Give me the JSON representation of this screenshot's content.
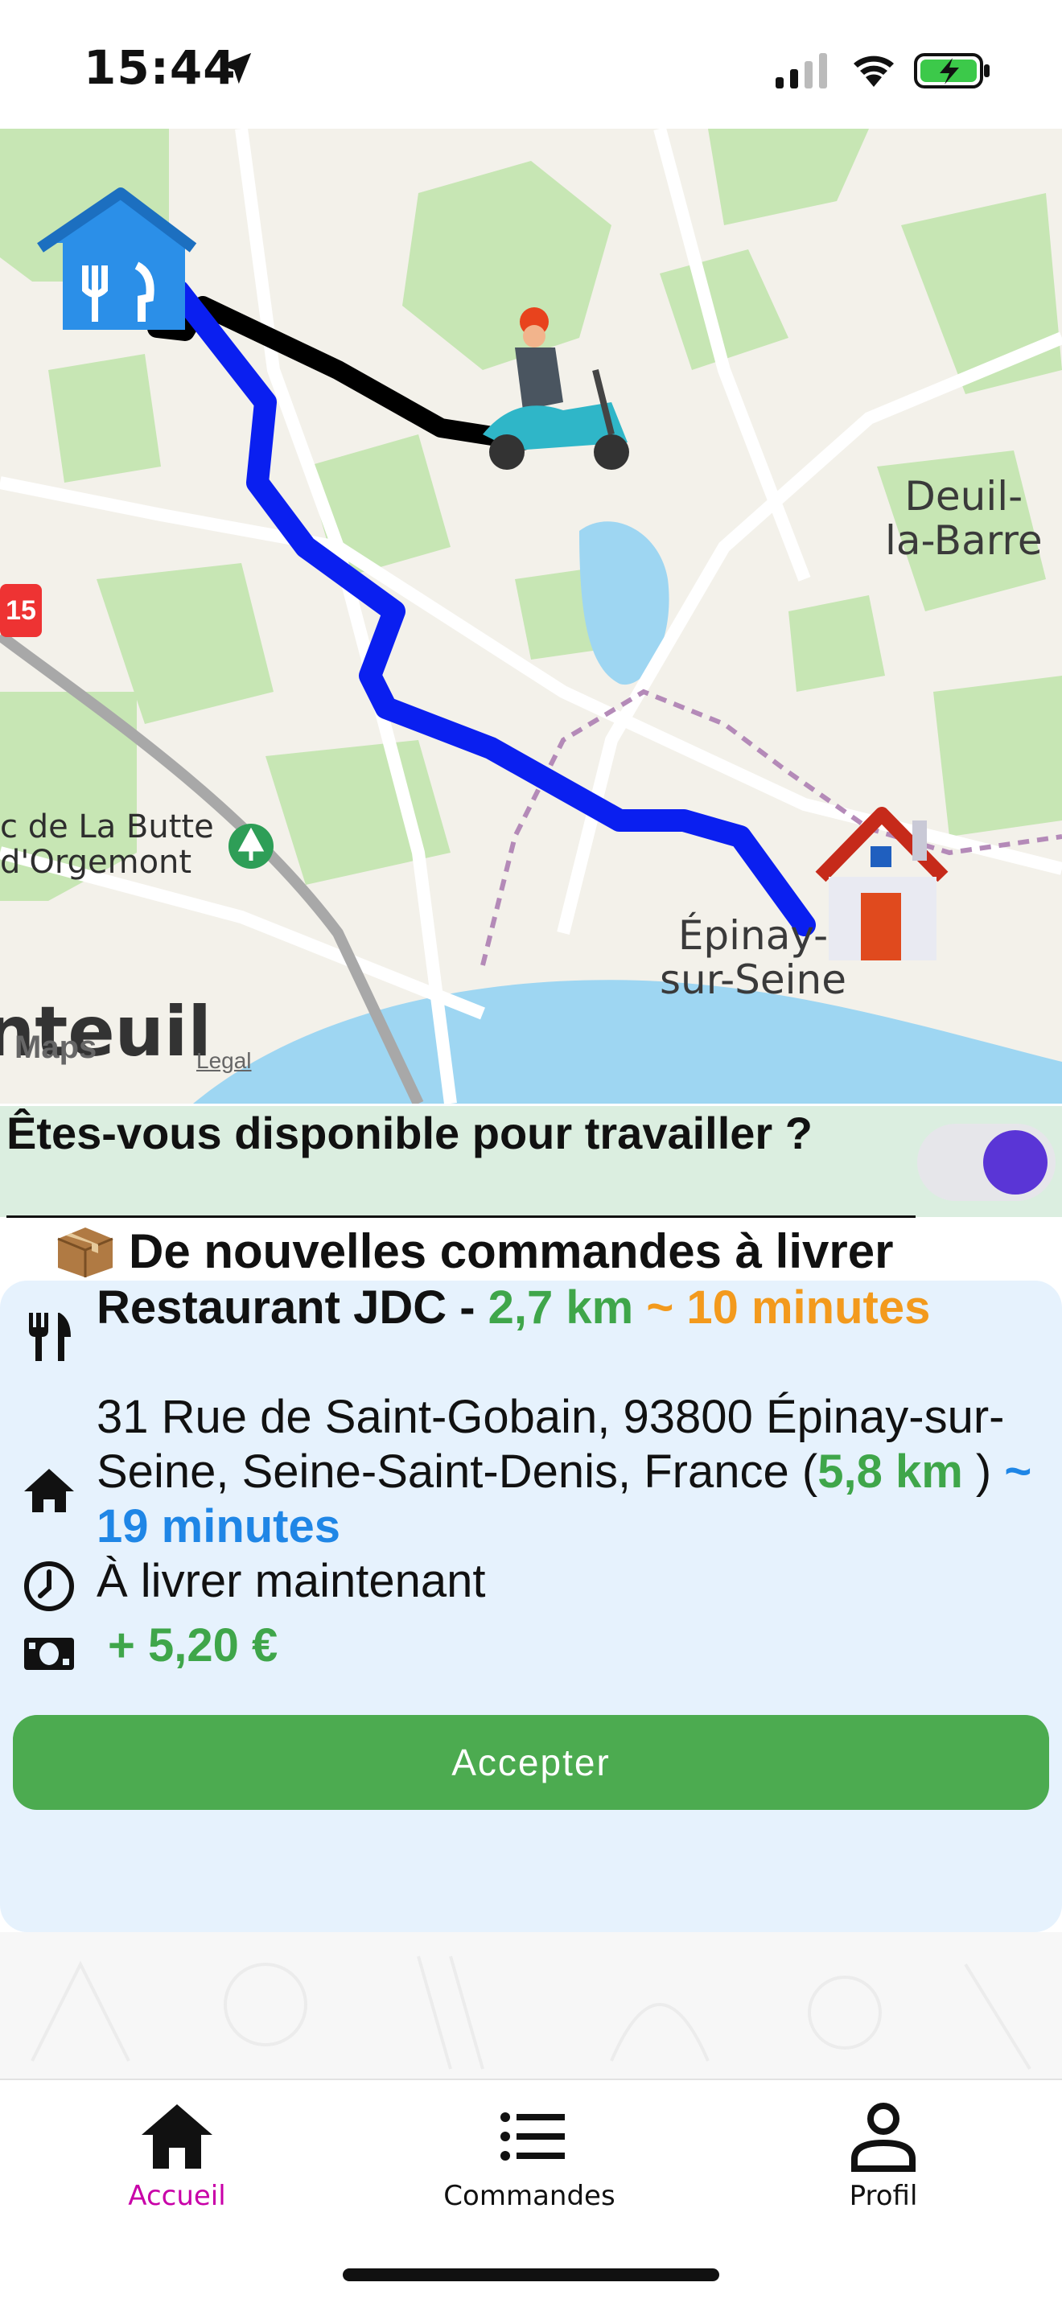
{
  "status_bar": {
    "time": "15:44"
  },
  "map": {
    "labels": {
      "deuil": "Deuil-\nla-Barre",
      "epinay": "Épinay-\nsur-Seine",
      "park": "c de La Butte\nd'Orgemont",
      "city_partial": "nteuil",
      "maps": "Maps",
      "legal": "Legal",
      "road": "15"
    },
    "route_colors": {
      "to_restaurant": "#000000",
      "to_customer": "#0a1ff0"
    }
  },
  "availability": {
    "question": "Êtes-vous disponible pour travailler ?",
    "toggle_on": true,
    "toggle_color": "#5a35d6"
  },
  "new_orders": {
    "title": "De nouvelles commandes à livrer"
  },
  "order": {
    "restaurant_name": "Restaurant JDC -",
    "restaurant_distance": "2,7 km",
    "restaurant_eta": "~ 10 minutes",
    "address_line": "31 Rue de Saint-Gobain, 93800 Épinay-sur-Seine, Seine-Saint-Denis, France (",
    "customer_distance": "5,8 km",
    "address_close": ")",
    "customer_eta": "~ 19 minutes",
    "delivery_time": "À livrer maintenant",
    "earnings": "+ 5,20 €",
    "accept_label": "Accepter"
  },
  "tabs": [
    {
      "label": "Accueil",
      "icon": "home-icon",
      "active": true
    },
    {
      "label": "Commandes",
      "icon": "list-icon",
      "active": false
    },
    {
      "label": "Profil",
      "icon": "profile-icon",
      "active": false
    }
  ],
  "colors": {
    "active_tab": "#c800a8",
    "accept": "#4cab50",
    "card": "#e6f2fd"
  }
}
